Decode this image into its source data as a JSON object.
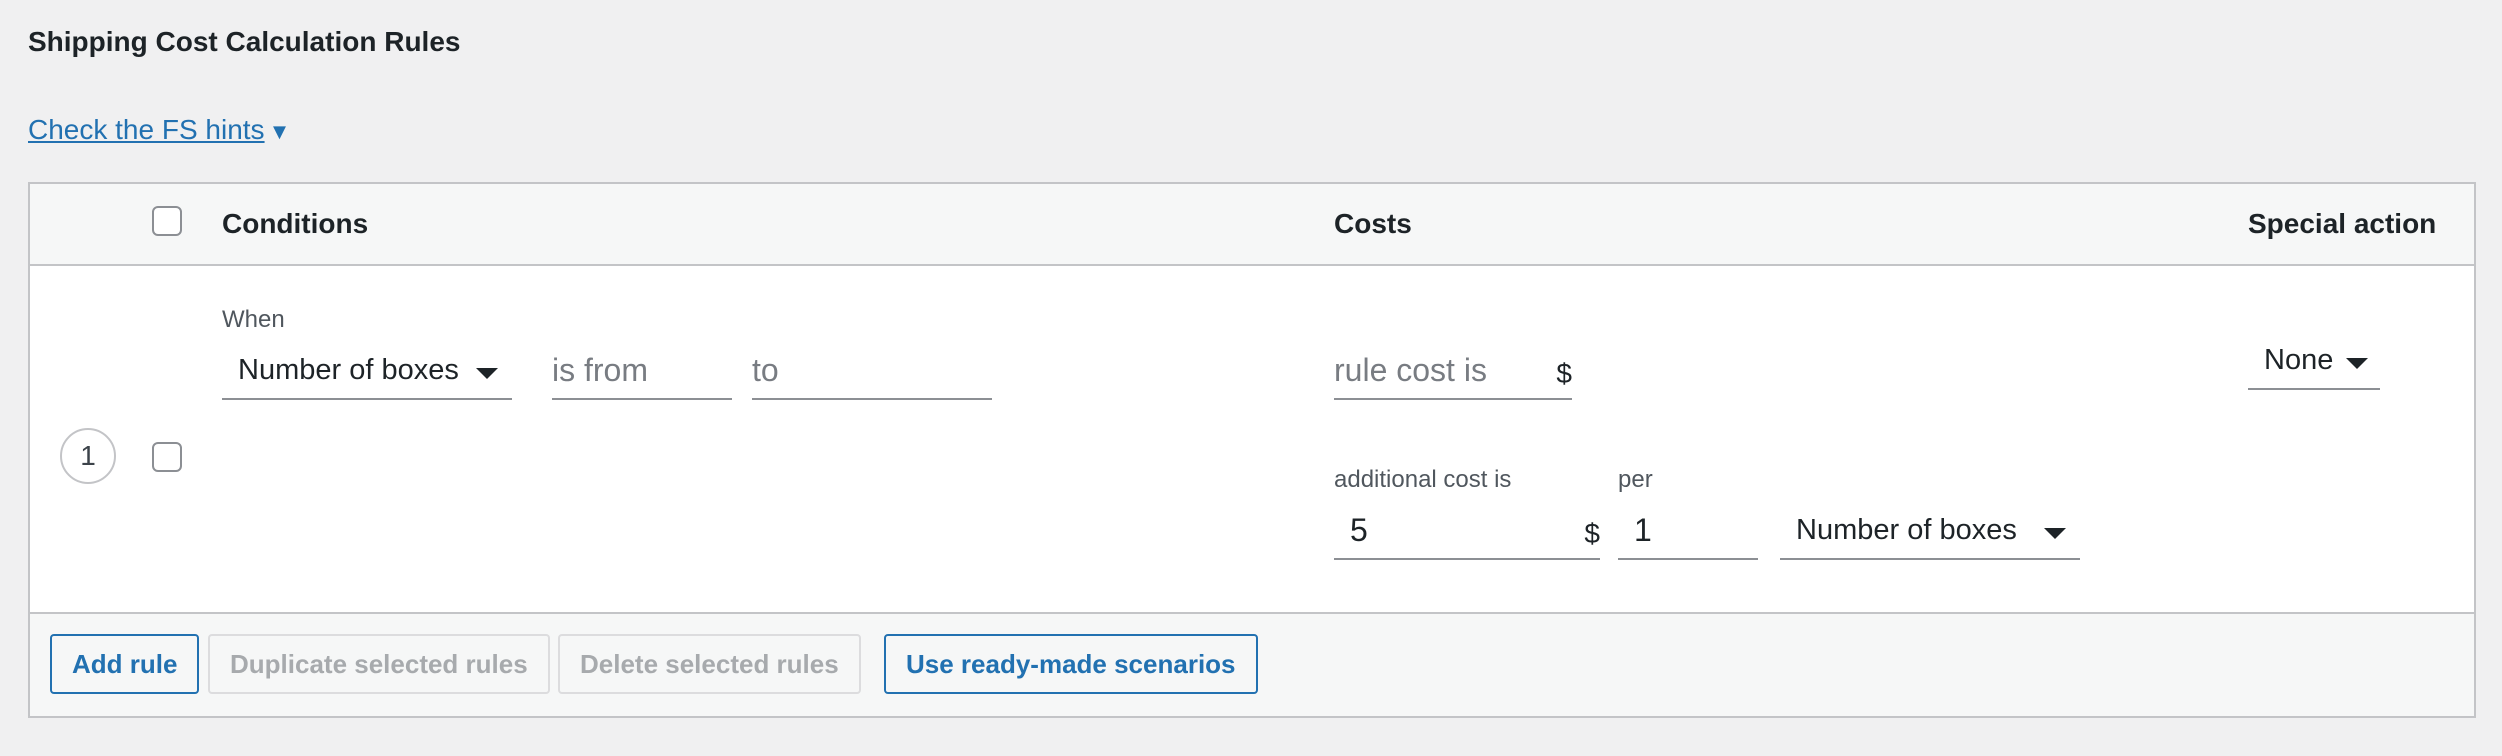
{
  "section": {
    "title": "Shipping Cost Calculation Rules",
    "hints_link": "Check the FS hints",
    "hints_arrow": "▼"
  },
  "table": {
    "headers": {
      "conditions": "Conditions",
      "costs": "Costs",
      "special_action": "Special action"
    },
    "rows": [
      {
        "number": "1",
        "when_label": "When",
        "condition_select": "Number of boxes",
        "from_placeholder": "is from",
        "to_placeholder": "to",
        "rule_cost_placeholder": "rule cost is",
        "currency": "$",
        "additional_cost_label": "additional cost is",
        "additional_cost_value": "5",
        "per_label": "per",
        "per_value": "1",
        "per_unit_select": "Number of boxes",
        "special_action_select": "None"
      }
    ]
  },
  "footer": {
    "add_rule": "Add rule",
    "duplicate": "Duplicate selected rules",
    "delete": "Delete selected rules",
    "scenarios": "Use ready-made scenarios"
  }
}
